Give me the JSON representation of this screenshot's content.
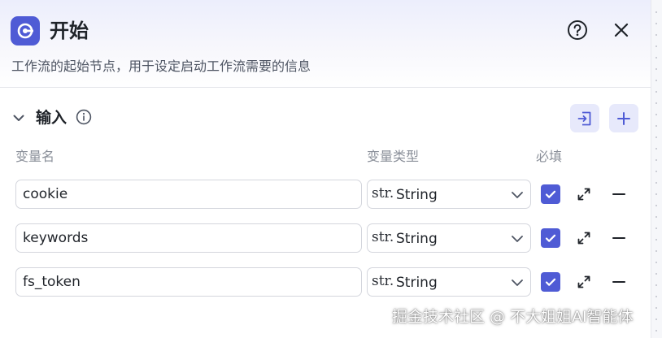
{
  "header": {
    "title": "开始",
    "description": "工作流的起始节点，用于设定启动工作流需要的信息"
  },
  "section": {
    "title": "输入"
  },
  "columns": {
    "name": "变量名",
    "type": "变量类型",
    "required": "必填"
  },
  "rows": [
    {
      "name": "cookie",
      "type_tag": "str.",
      "type": "String",
      "required": true
    },
    {
      "name": "keywords",
      "type_tag": "str.",
      "type": "String",
      "required": true
    },
    {
      "name": "fs_token",
      "type_tag": "str.",
      "type": "String",
      "required": true
    }
  ],
  "watermark": "掘金技术社区 @ 不大姐姐AI智能体",
  "colors": {
    "accent": "#4f5bd5",
    "accent_soft": "#e7e9fb"
  }
}
